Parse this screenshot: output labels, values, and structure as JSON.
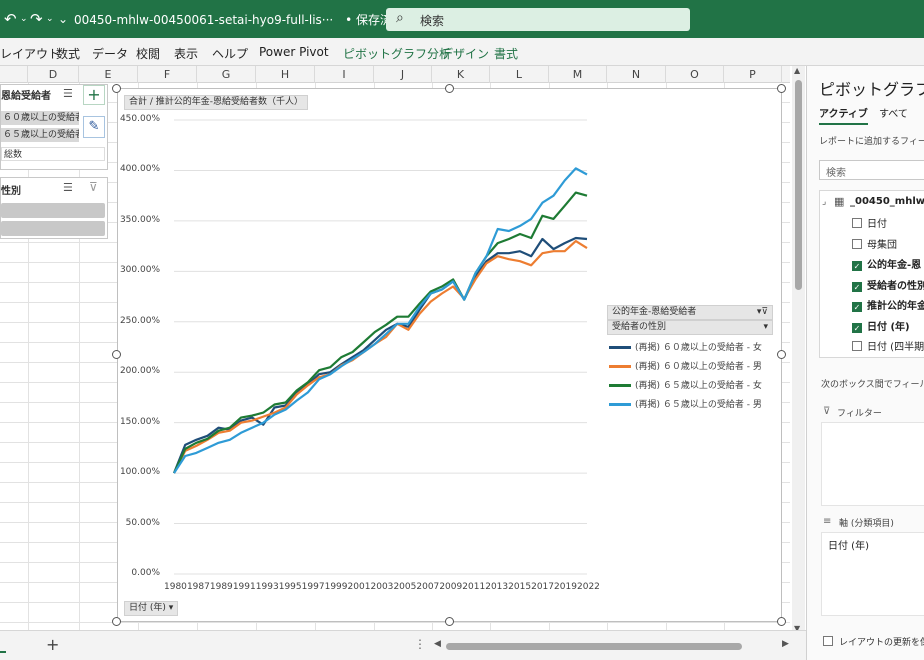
{
  "titlebar": {
    "doc_title": "00450-mhlw-00450061-setai-hyo9-full-lis···",
    "save_state": "• 保存済み ⌵",
    "search_placeholder": "検索",
    "undo_glyph": "↶",
    "redo_glyph": "↷",
    "more_glyph": "⌄"
  },
  "ribbon": {
    "tabs": [
      "レイアウト",
      "数式",
      "データ",
      "校閲",
      "表示",
      "ヘルプ",
      "Power Pivot",
      "ピボットグラフ分析",
      "デザイン",
      "書式"
    ]
  },
  "columns": [
    "D",
    "E",
    "F",
    "G",
    "H",
    "I",
    "J",
    "K",
    "L",
    "M",
    "N",
    "O",
    "P"
  ],
  "slicer1": {
    "title": "恩給受給者",
    "items": [
      "６０歳以上の受給者",
      "６５歳以上の受給者",
      "総数"
    ]
  },
  "slicer2": {
    "title": "性別"
  },
  "chart": {
    "value_field_button": "合計 / 推計公的年金-恩給受給者数（千人）",
    "axis_field_button": "日付 (年)",
    "legend_field_button1": "公的年金-恩給受給者",
    "legend_field_button2": "受給者の性別"
  },
  "chart_data": {
    "type": "line",
    "title": "",
    "xlabel": "",
    "ylabel": "",
    "ylim": [
      0,
      450
    ],
    "y_ticks": [
      "0.00%",
      "50.00%",
      "100.00%",
      "150.00%",
      "200.00%",
      "250.00%",
      "300.00%",
      "350.00%",
      "400.00%",
      "450.00%"
    ],
    "x_tick_labels": [
      "1980",
      "1987",
      "1989",
      "1991",
      "1993",
      "1995",
      "1997",
      "1999",
      "2001",
      "2003",
      "2005",
      "2007",
      "2009",
      "2011",
      "2013",
      "2015",
      "2017",
      "2019",
      "2022"
    ],
    "x": [
      "1980",
      "1986",
      "1987",
      "1988",
      "1989",
      "1990",
      "1991",
      "1992",
      "1993",
      "1994",
      "1995",
      "1996",
      "1997",
      "1998",
      "1999",
      "2000",
      "2001",
      "2002",
      "2003",
      "2004",
      "2005",
      "2006",
      "2007",
      "2008",
      "2009",
      "2010",
      "2011",
      "2012",
      "2013",
      "2014",
      "2015",
      "2016",
      "2017",
      "2018",
      "2019",
      "2020",
      "2021",
      "2022"
    ],
    "series": [
      {
        "name": "(再掲) ６０歳以上の受給者 - 女",
        "color": "#1f4e79",
        "values": [
          100,
          128,
          133,
          137,
          145,
          143,
          152,
          155,
          148,
          165,
          167,
          180,
          188,
          198,
          200,
          208,
          215,
          222,
          232,
          242,
          248,
          245,
          262,
          278,
          282,
          290,
          272,
          295,
          310,
          318,
          318,
          320,
          315,
          332,
          322,
          328,
          333,
          332
        ]
      },
      {
        "name": "(再掲) ６０歳以上の受給者 - 男",
        "color": "#ed7d31",
        "values": [
          100,
          122,
          127,
          133,
          140,
          142,
          150,
          152,
          156,
          160,
          165,
          178,
          187,
          195,
          198,
          207,
          212,
          220,
          228,
          235,
          248,
          242,
          258,
          270,
          278,
          285,
          273,
          292,
          308,
          315,
          312,
          310,
          306,
          318,
          320,
          320,
          330,
          323
        ]
      },
      {
        "name": "(再掲) ６５歳以上の受給者 - 女",
        "color": "#1e7b34",
        "values": [
          100,
          124,
          130,
          134,
          142,
          145,
          155,
          157,
          160,
          168,
          170,
          182,
          190,
          202,
          205,
          215,
          220,
          230,
          240,
          247,
          255,
          255,
          268,
          280,
          285,
          292,
          272,
          298,
          315,
          328,
          332,
          337,
          333,
          355,
          352,
          365,
          378,
          375
        ]
      },
      {
        "name": "(再掲) ６５歳以上の受給者 - 男",
        "color": "#2e9bd6",
        "values": [
          100,
          117,
          120,
          125,
          130,
          133,
          140,
          145,
          150,
          158,
          163,
          172,
          180,
          193,
          198,
          206,
          213,
          220,
          228,
          238,
          248,
          248,
          265,
          278,
          282,
          290,
          272,
          298,
          315,
          342,
          340,
          345,
          352,
          368,
          375,
          390,
          402,
          396
        ]
      }
    ]
  },
  "pane": {
    "title": "ピボットグラフの",
    "tabs": [
      "アクティブ",
      "すべて"
    ],
    "hint": "レポートに追加するフィール",
    "search_placeholder": "検索",
    "table_name": "_00450_mhlw",
    "fields": [
      {
        "label": "日付",
        "checked": false,
        "bold": false
      },
      {
        "label": "母集団",
        "checked": false,
        "bold": false
      },
      {
        "label": "公的年金-恩",
        "checked": true,
        "bold": true
      },
      {
        "label": "受給者の性別",
        "checked": true,
        "bold": true
      },
      {
        "label": "推計公的年金",
        "checked": true,
        "bold": true
      },
      {
        "label": "日付 (年)",
        "checked": true,
        "bold": true
      },
      {
        "label": "日付 (四半期",
        "checked": false,
        "bold": false
      }
    ],
    "drag_hint": "次のボックス間でフィールドを",
    "filter_label": "フィルター",
    "axis_label": "軸 (分類項目)",
    "axis_value": "日付 (年)",
    "defer_label": "レイアウトの更新を保"
  },
  "bottom": {
    "add_sheet": "+",
    "more": "⋮"
  }
}
